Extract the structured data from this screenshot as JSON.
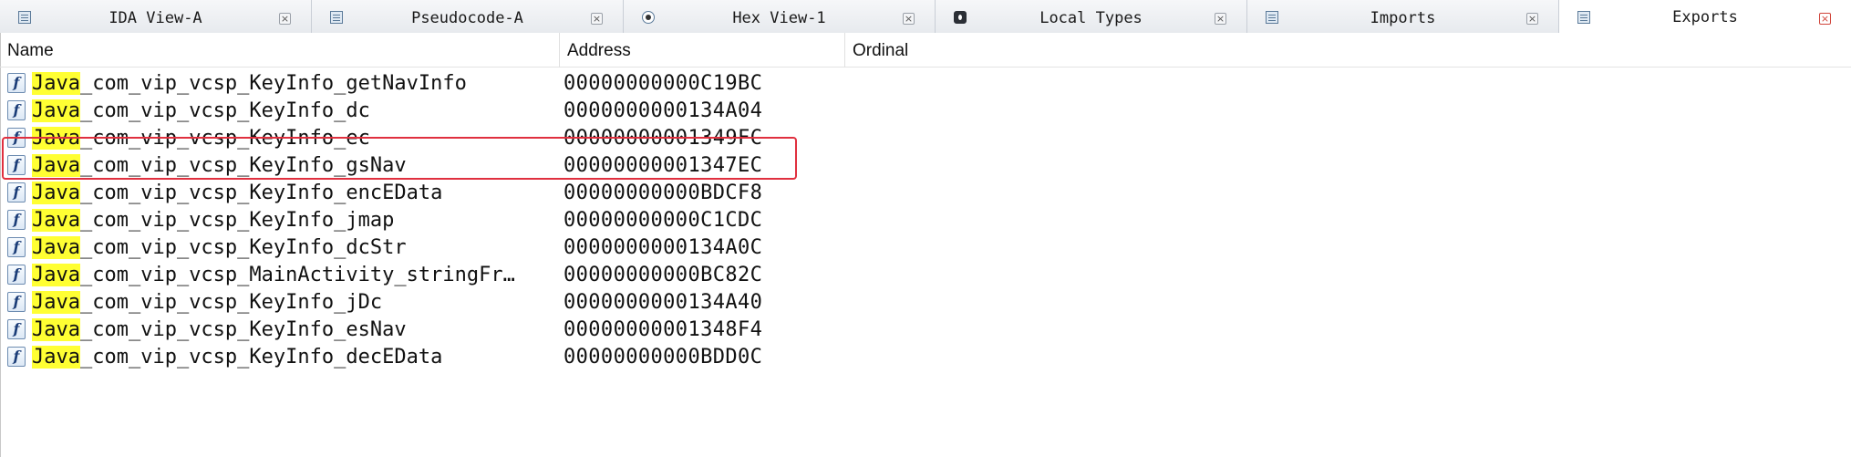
{
  "tabs": [
    {
      "label": "IDA View-A",
      "icon": "ida-view-icon",
      "close": "×"
    },
    {
      "label": "Pseudocode-A",
      "icon": "pseudocode-icon",
      "close": "×"
    },
    {
      "label": "Hex View-1",
      "icon": "hex-view-icon",
      "close": "×"
    },
    {
      "label": "Local Types",
      "icon": "local-types-icon",
      "close": "×"
    },
    {
      "label": "Imports",
      "icon": "imports-icon",
      "close": "×"
    },
    {
      "label": "Exports",
      "icon": "exports-icon",
      "close": "×",
      "active": true
    }
  ],
  "columns": {
    "name": "Name",
    "address": "Address",
    "ordinal": "Ordinal"
  },
  "function_icon_glyph": "f",
  "highlight_prefix": "Java",
  "rows": [
    {
      "name_rest": "_com_vip_vcsp_KeyInfo_getNavInfo",
      "address": "00000000000C19BC"
    },
    {
      "name_rest": "_com_vip_vcsp_KeyInfo_dc",
      "address": "0000000000134A04"
    },
    {
      "name_rest": "_com_vip_vcsp_KeyInfo_ec",
      "address": "00000000001349FC"
    },
    {
      "name_rest": "_com_vip_vcsp_KeyInfo_gsNav",
      "address": "00000000001347EC"
    },
    {
      "name_rest": "_com_vip_vcsp_KeyInfo_encEData",
      "address": "00000000000BDCF8"
    },
    {
      "name_rest": "_com_vip_vcsp_KeyInfo_jmap",
      "address": "00000000000C1CDC"
    },
    {
      "name_rest": "_com_vip_vcsp_KeyInfo_dcStr",
      "address": "0000000000134A0C"
    },
    {
      "name_rest": "_com_vip_vcsp_MainActivity_stringFr…",
      "address": "00000000000BC82C"
    },
    {
      "name_rest": "_com_vip_vcsp_KeyInfo_jDc",
      "address": "0000000000134A40"
    },
    {
      "name_rest": "_com_vip_vcsp_KeyInfo_esNav",
      "address": "00000000001348F4"
    },
    {
      "name_rest": "_com_vip_vcsp_KeyInfo_decEData",
      "address": "00000000000BDD0C"
    }
  ],
  "colors": {
    "highlight": "#ffff33",
    "annotation": "#e0303f",
    "tab_accent": "#7a8fa8"
  }
}
